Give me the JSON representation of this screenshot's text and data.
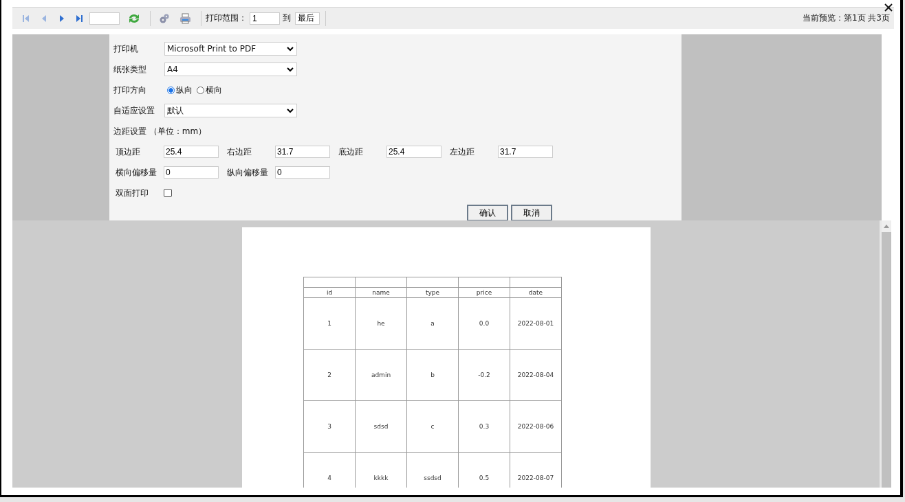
{
  "toolbar": {
    "range_label": "打印范围：",
    "range_from": "1",
    "to_label": "到",
    "range_to": "最后",
    "preview_status": "当前预览：第1页 共3页"
  },
  "settings": {
    "printer": {
      "label": "打印机",
      "value": "Microsoft Print to PDF"
    },
    "paper": {
      "label": "纸张类型",
      "value": "A4"
    },
    "orientation": {
      "label": "打印方向",
      "options": [
        {
          "label": "纵向",
          "selected": true
        },
        {
          "label": "横向",
          "selected": false
        }
      ]
    },
    "fit": {
      "label": "自适应设置",
      "value": "默认"
    },
    "margins_title": "边距设置 （单位：mm）",
    "margins": [
      {
        "label": "顶边距",
        "value": "25.4"
      },
      {
        "label": "右边距",
        "value": "31.7"
      },
      {
        "label": "底边距",
        "value": "25.4"
      },
      {
        "label": "左边距",
        "value": "31.7"
      }
    ],
    "offsets": [
      {
        "label": "横向偏移量",
        "value": "0"
      },
      {
        "label": "纵向偏移量",
        "value": "0"
      }
    ],
    "duplex": {
      "label": "双面打印",
      "checked": false
    },
    "buttons": [
      "确认",
      "取消"
    ]
  },
  "preview": {
    "columns": [
      "id",
      "name",
      "type",
      "price",
      "date"
    ],
    "rows": [
      [
        "1",
        "he",
        "a",
        "0.0",
        "2022-08-01"
      ],
      [
        "2",
        "admin",
        "b",
        "-0.2",
        "2022-08-04"
      ],
      [
        "3",
        "sdsd",
        "c",
        "0.3",
        "2022-08-06"
      ],
      [
        "4",
        "kkkk",
        "ssdsd",
        "0.5",
        "2022-08-07"
      ]
    ]
  }
}
